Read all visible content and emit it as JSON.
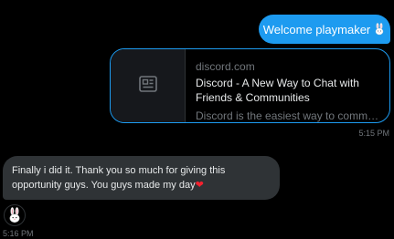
{
  "conversation": {
    "sent_message": {
      "text": "Welcome playmaker",
      "emoji": "rabbit-icon"
    },
    "link_card": {
      "domain": "discord.com",
      "title": "Discord - A New Way to Chat with Friends & Communities",
      "description": "Discord is the easiest way to commun…",
      "thumbnail_icon": "article-icon"
    },
    "sent_time": "5:15 PM",
    "received_message": {
      "text": "Finally i did it. Thank you so much for giving this opportunity guys. You guys made my day",
      "emoji": "❤"
    },
    "avatar_icon": "rabbit-avatar-icon",
    "received_time": "5:16 PM"
  },
  "colors": {
    "background": "#000000",
    "sent_bubble": "#1d9bf0",
    "received_bubble": "#2f3336",
    "card_border": "#1d9bf0",
    "muted_text": "#71767b",
    "heart": "#f4212e"
  }
}
